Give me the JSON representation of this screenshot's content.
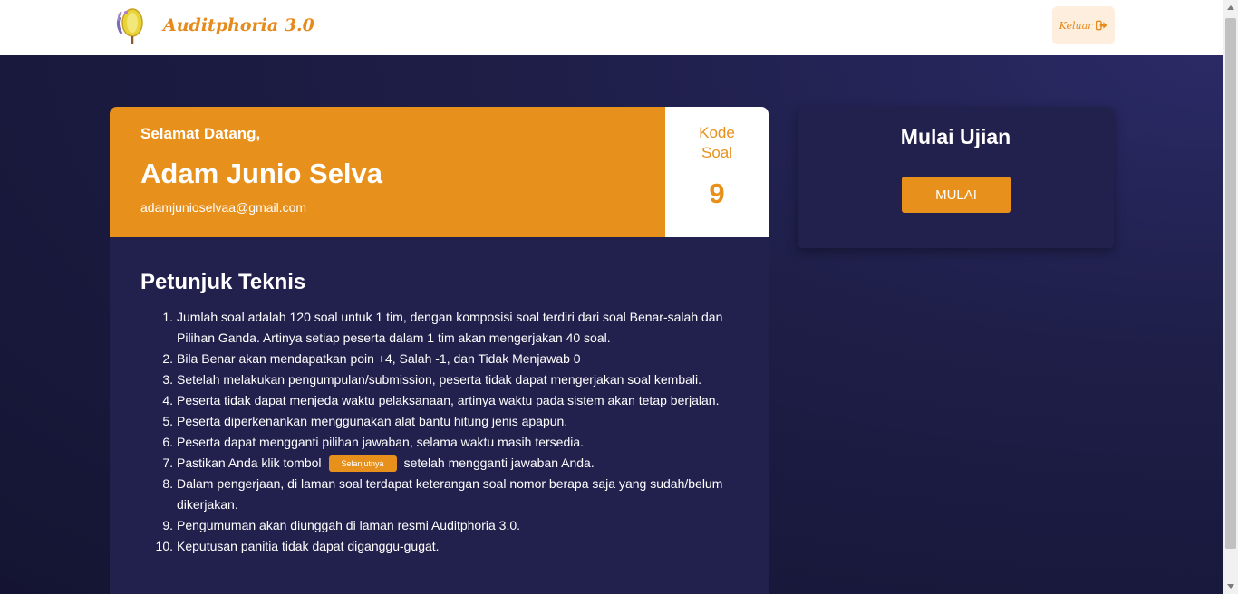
{
  "navbar": {
    "brand_name": "Auditphoria 3.0",
    "logout_label": "Keluar",
    "logout_icon": "sign-out-icon"
  },
  "welcome": {
    "greeting": "Selamat Datang,",
    "name": "Adam Junio Selva",
    "email": "adamjunioselvaa@gmail.com"
  },
  "code": {
    "label": "Kode Soal",
    "value": "9"
  },
  "instructions": {
    "title": "Petunjuk Teknis",
    "items": [
      {
        "num": "1.",
        "text": "Jumlah soal adalah 120 soal untuk 1 tim, dengan komposisi soal terdiri dari soal Benar-salah dan Pilihan Ganda. Artinya setiap peserta dalam 1 tim akan mengerjakan 40 soal."
      },
      {
        "num": "2.",
        "text": "Bila Benar akan mendapatkan poin +4, Salah -1, dan Tidak Menjawab 0"
      },
      {
        "num": "3.",
        "text": "Setelah melakukan pengumpulan/submission, peserta tidak dapat mengerjakan soal kembali."
      },
      {
        "num": "4.",
        "text": "Peserta tidak dapat menjeda waktu pelaksanaan, artinya waktu pada sistem akan tetap berjalan."
      },
      {
        "num": "5.",
        "text": "Peserta diperkenankan menggunakan alat bantu hitung jenis apapun."
      },
      {
        "num": "6.",
        "text": "Peserta dapat mengganti pilihan jawaban, selama waktu masih tersedia."
      },
      {
        "num": "7.",
        "text_before": "Pastikan Anda klik tombol",
        "button": "Selanjutnya",
        "text_after": "setelah mengganti jawaban Anda."
      },
      {
        "num": "8.",
        "text": "Dalam pengerjaan, di laman soal terdapat keterangan soal nomor berapa saja yang sudah/belum dikerjakan."
      },
      {
        "num": "9.",
        "text": "Pengumuman akan diunggah di laman resmi Auditphoria 3.0."
      },
      {
        "num": "10.",
        "text": "Keputusan panitia tidak dapat diganggu-gugat."
      }
    ]
  },
  "exam": {
    "title": "Mulai Ujian",
    "button_label": "MULAI"
  },
  "colors": {
    "accent": "#e8901c",
    "card": "#22214d",
    "background": "#1b1b3d"
  }
}
